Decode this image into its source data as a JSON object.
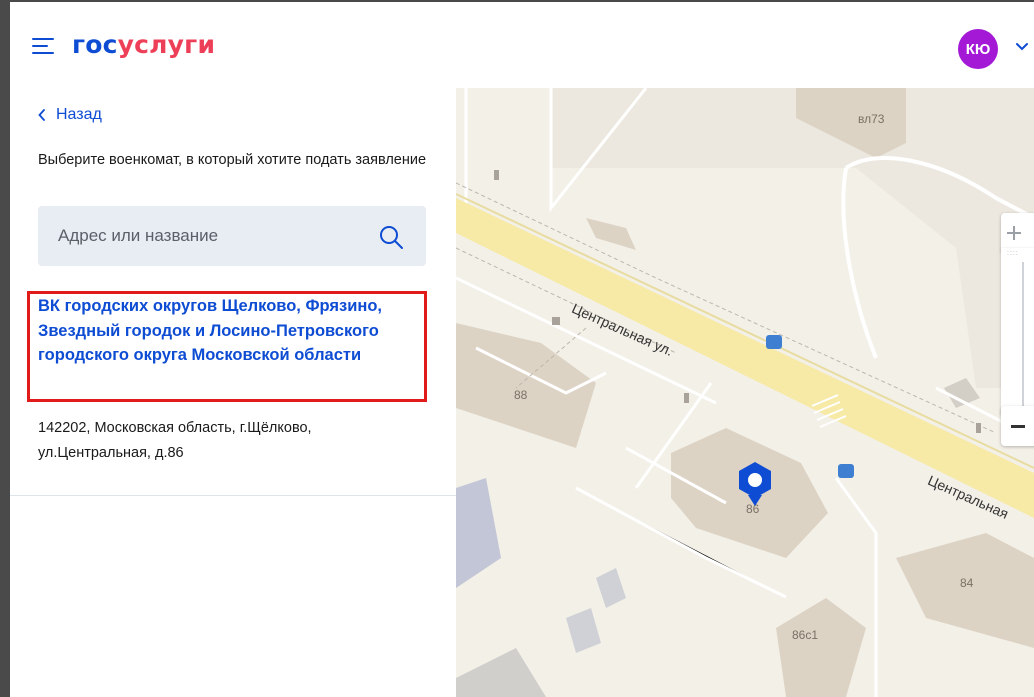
{
  "header": {
    "logo_part1": "гос",
    "logo_part2": "услуги",
    "avatar_initials": "КЮ"
  },
  "panel": {
    "back_label": "Назад",
    "prompt": "Выберите военкомат, в который хотите подать заявление",
    "search_placeholder": "Адрес или название",
    "result": {
      "title": "ВК городских округов Щелково, Фрязино, Звездный городок и Лосино-Петровского городского округа Московской области",
      "address": "142202, Московская область, г.Щёлково, ул.Центральная, д.86"
    }
  },
  "map": {
    "street_name": "Центральная ул.",
    "street_name_2": "Центральная",
    "buildings": {
      "b_vl73": "вл73",
      "b_88": "88",
      "b_86": "86",
      "b_84": "84",
      "b_86c1": "86с1"
    }
  },
  "colors": {
    "brand_blue": "#0d4cd3",
    "brand_red": "#ee3f58",
    "avatar": "#a319d6",
    "highlight": "#e11a1a"
  }
}
